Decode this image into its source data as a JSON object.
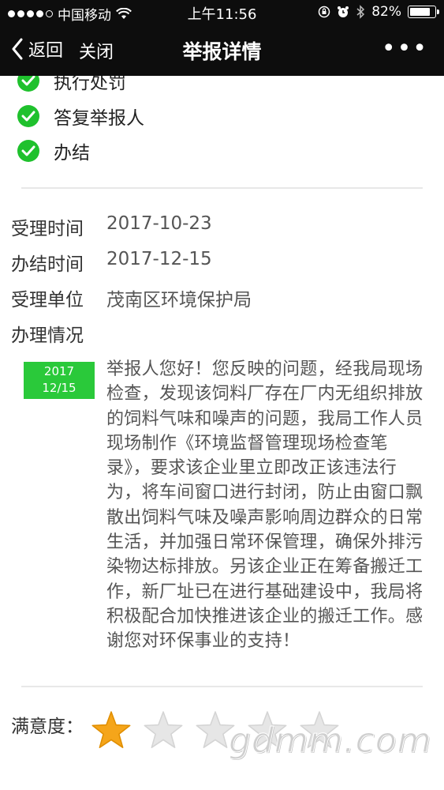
{
  "status_bar": {
    "carrier": "中国移动",
    "time": "上午11:56",
    "battery": "82%",
    "battery_level": 0.82
  },
  "nav": {
    "back_label": "返回",
    "close_label": "关闭",
    "title": "举报详情",
    "more_label": "•••"
  },
  "steps": [
    {
      "label": "执行处罚"
    },
    {
      "label": "答复举报人"
    },
    {
      "label": "办结"
    }
  ],
  "details": {
    "accept_time_label": "受理时间",
    "accept_time": "2017-10-23",
    "finish_time_label": "办结时间",
    "finish_time": "2017-12-15",
    "unit_label": "受理单位",
    "unit": "茂南区环境保护局",
    "status_label": "办理情况"
  },
  "reply": {
    "date_year": "2017",
    "date_md": "12/15",
    "text": "举报人您好！您反映的问题，经我局现场检查，发现该饲料厂存在厂内无组织排放的饲料气味和噪声的问题，我局工作人员现场制作《环境监督管理现场检查笔录》，要求该企业里立即改正该违法行为，将车间窗口进行封闭，防止由窗口飘散出饲料气味及噪声影响周边群众的日常生活，并加强日常环保管理，确保外排污染物达标排放。另该企业正在筹备搬迁工作，新厂址已在进行基础建设中，我局将积极配合加快推进该企业的搬迁工作。感谢您对环保事业的支持！"
  },
  "rating": {
    "label": "满意度：",
    "value": 1,
    "max": 5
  },
  "watermark": "gdmm.com",
  "colors": {
    "check_green": "#1fc12d",
    "badge_green": "#2ac93a",
    "star_active": "#f5a51a",
    "star_inactive": "#e6e6e6"
  }
}
